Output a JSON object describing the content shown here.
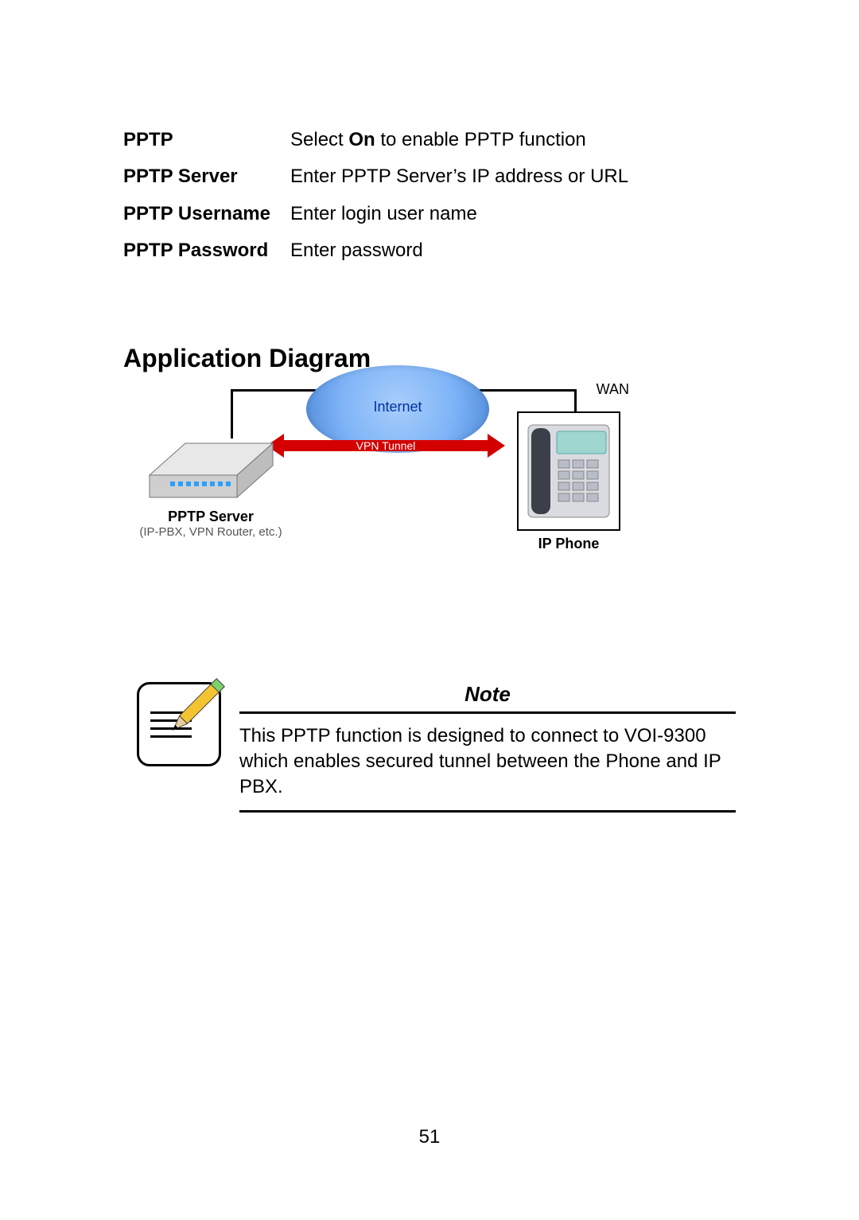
{
  "defs": [
    {
      "term": "PPTP",
      "desc_pre": "Select ",
      "desc_bold": "On",
      "desc_post": " to enable PPTP function"
    },
    {
      "term": "PPTP Server",
      "desc_pre": "Enter PPTP Server",
      "desc_bold": "",
      "desc_post": "’s IP address or URL"
    },
    {
      "term": "PPTP Username",
      "desc_pre": "Enter login user name",
      "desc_bold": "",
      "desc_post": ""
    },
    {
      "term": "PPTP Password",
      "desc_pre": "Enter password",
      "desc_bold": "",
      "desc_post": ""
    }
  ],
  "section_heading": "Application Diagram",
  "diagram": {
    "wan": "WAN",
    "internet": "Internet",
    "vpn": "VPN Tunnel",
    "server_title": "PPTP Server",
    "server_sub": "(IP-PBX, VPN Router, etc.)",
    "phone_title": "IP Phone"
  },
  "note": {
    "heading": "Note",
    "text": "This PPTP function is designed to connect to VOI-9300 which enables secured tunnel between the Phone and IP PBX."
  },
  "page_number": "51"
}
